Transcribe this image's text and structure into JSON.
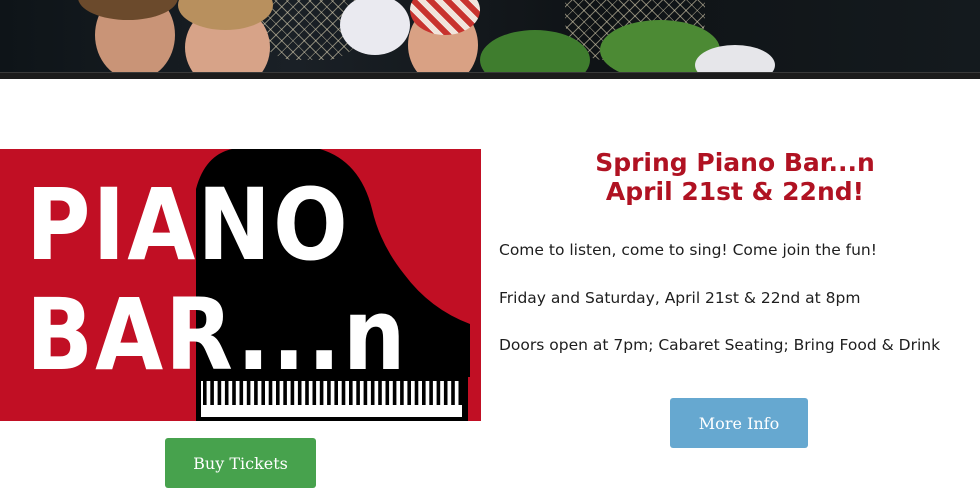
{
  "hero": {
    "image_name": "cast-photo-banner"
  },
  "promo": {
    "word1": "PIANO",
    "word2": "BAR...n",
    "background_color": "#c10f24"
  },
  "event": {
    "title_line1": "Spring Piano Bar...n",
    "title_line2": "April 21st & 22nd!",
    "title_color": "#b01222",
    "description": [
      "Come to listen, come to sing!  Come join the fun!",
      "Friday and Saturday, April 21st & 22nd at 8pm",
      "Doors open at 7pm; Cabaret Seating; Bring Food & Drink"
    ]
  },
  "buttons": {
    "buy_tickets": "Buy Tickets",
    "buy_tickets_color": "#47a24d",
    "more_info": "More Info",
    "more_info_color": "#66a8d0"
  }
}
